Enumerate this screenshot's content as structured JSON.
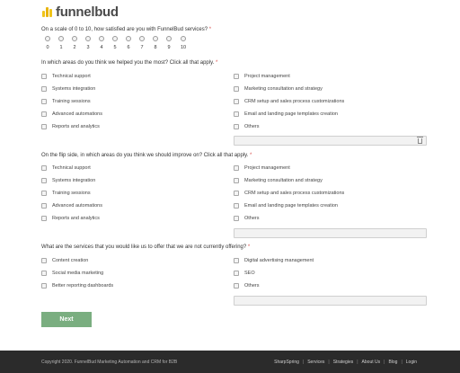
{
  "brand": {
    "name": "funnelbud",
    "accent": "#f0c419"
  },
  "q1": {
    "text": "On a scale of 0 to 10, how satisfied are you with FunnelBud services?",
    "required_mark": "*",
    "scale": [
      "0",
      "1",
      "2",
      "3",
      "4",
      "5",
      "6",
      "7",
      "8",
      "9",
      "10"
    ]
  },
  "q2": {
    "text": "In which areas do you think we helped you the most? Click all that apply.",
    "required_mark": "*",
    "left": [
      "Technical support",
      "Systems integration",
      "Training sessions",
      "Advanced automations",
      "Reports and analytics"
    ],
    "right": [
      "Project management",
      "Marketing consultation and strategy",
      "CRM setup and sales process customizations",
      "Email and landing page templates creation",
      "Others"
    ]
  },
  "q3": {
    "text": "On the flip side, in which areas do you think we should improve on? Click all that apply.",
    "required_mark": "*",
    "left": [
      "Technical support",
      "Systems integration",
      "Training sessions",
      "Advanced automations",
      "Reports and analytics"
    ],
    "right": [
      "Project management",
      "Marketing consultation and strategy",
      "CRM setup and sales process customizations",
      "Email and landing page templates creation",
      "Others"
    ]
  },
  "q4": {
    "text": "What are the services that you would like us to offer that we are not currently offering?",
    "required_mark": "*",
    "left": [
      "Content creation",
      "Social media marketing",
      "Better reporting dashboards"
    ],
    "right": [
      "Digital advertising management",
      "SEO",
      "Others"
    ]
  },
  "actions": {
    "next_label": "Next",
    "next_color": "#7aae80"
  },
  "footer": {
    "copyright": "Copyright 2020. FunnelBud Marketing Automation and CRM for B2B",
    "links": [
      "SharpSpring",
      "Services",
      "Strategies",
      "About Us",
      "Blog",
      "Login"
    ]
  }
}
